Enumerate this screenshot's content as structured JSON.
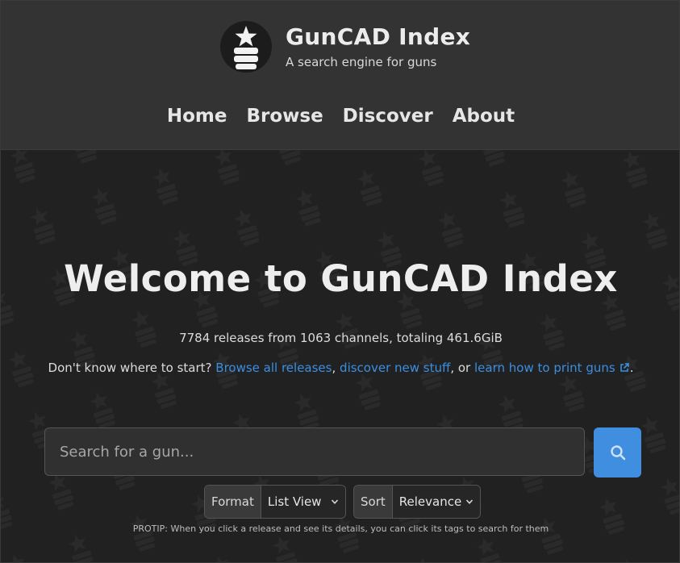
{
  "header": {
    "title": "GunCAD Index",
    "tagline": "A search engine for guns",
    "logo_icon": "gun-magazine-star-icon"
  },
  "nav": {
    "items": [
      {
        "label": "Home"
      },
      {
        "label": "Browse"
      },
      {
        "label": "Discover"
      },
      {
        "label": "About"
      }
    ]
  },
  "hero": {
    "title": "Welcome to GunCAD Index",
    "stats": "7784 releases from 1063 channels, totaling 461.6GiB",
    "start_prefix": "Don't know where to start?",
    "link_browse": "Browse all releases",
    "sep1": ",",
    "link_discover": "discover new stuff",
    "sep2": ", or",
    "link_learn": "learn how to print guns",
    "end": "."
  },
  "search": {
    "placeholder": "Search for a gun...",
    "button_icon": "search-icon"
  },
  "format": {
    "label": "Format",
    "selected": "List View"
  },
  "sort": {
    "label": "Sort",
    "selected": "Relevance"
  },
  "protip": "PROTIP: When you click a release and see its details, you can click its tags to search for them",
  "colors": {
    "link": "#3a8fe3",
    "button": "#3f8ee0",
    "header_bg": "#333333",
    "hero_bg": "#212121"
  }
}
